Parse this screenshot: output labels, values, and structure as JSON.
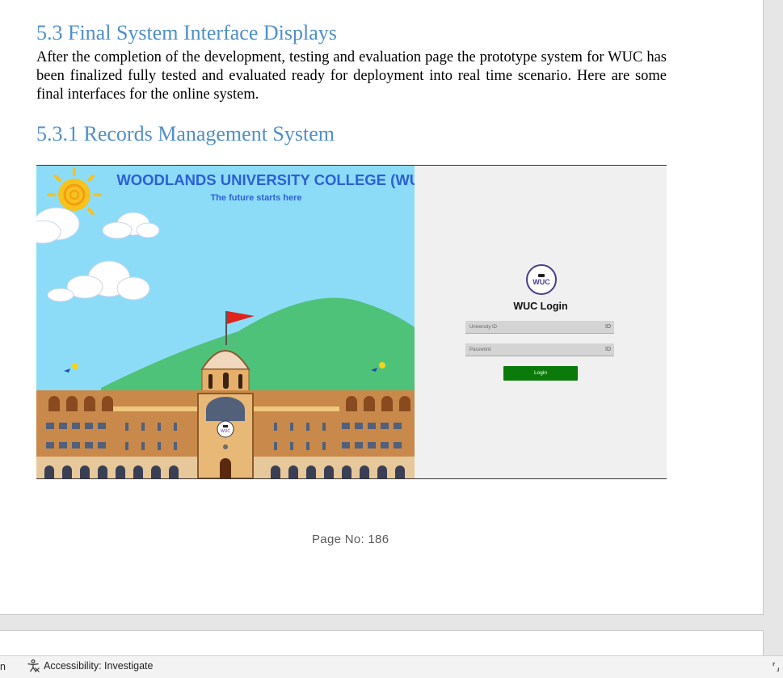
{
  "document": {
    "heading_5_3": "5.3 Final System Interface Displays",
    "paragraph": "After the completion of the development, testing and evaluation page the prototype system for WUC has been finalized fully tested and evaluated ready for deployment into real time scenario. Here are some final interfaces for the online system.",
    "heading_5_3_1": "5.3.1 Records Management System",
    "page_number": "Page No: 186"
  },
  "screenshot": {
    "banner_title": "WOODLANDS UNIVERSITY COLLEGE (WUC)",
    "tagline": "The future starts here",
    "building_badge": "WUC",
    "logo_text": "WUC",
    "login_title": "WUC Login",
    "university_id_placeholder": "University ID",
    "password_placeholder": "Password",
    "login_button": "Login",
    "field_icon": "ID",
    "colors": {
      "sky": "#8ddcf7",
      "hill": "#4fc27a",
      "building": "#c8894a",
      "title": "#2c5fd6",
      "login_button": "#0a7a0a"
    }
  },
  "statusbar": {
    "left_fragment": "n",
    "accessibility": "Accessibility: Investigate"
  }
}
